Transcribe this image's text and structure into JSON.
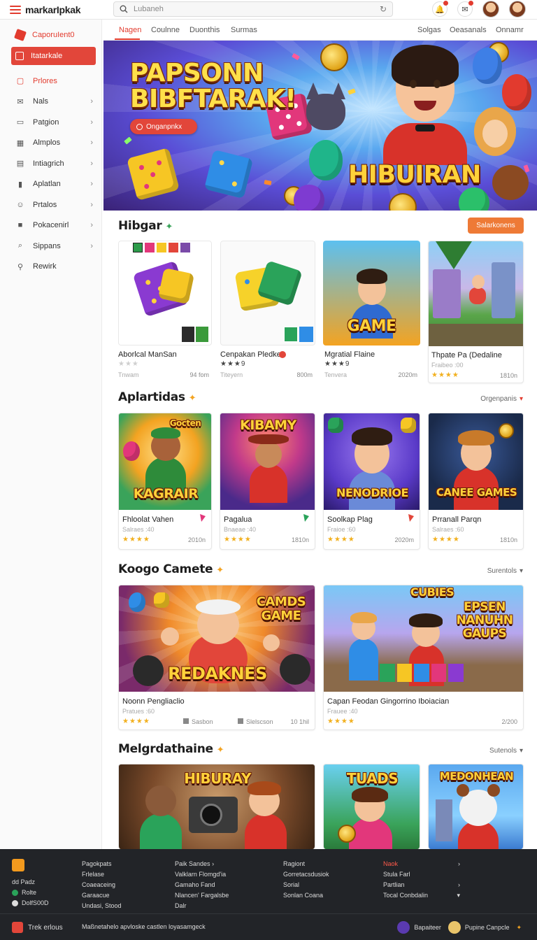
{
  "app": {
    "logo_text": "markarIpkak",
    "search_placeholder": "Lubaneh"
  },
  "sidebar": {
    "top_label": "CaporuIent0",
    "active_label": "Itatarkale",
    "items": [
      {
        "label": "Prlores",
        "icon": "folder-icon",
        "highlight": true,
        "chevron": false
      },
      {
        "label": "Nals",
        "icon": "mail-icon",
        "highlight": false,
        "chevron": true
      },
      {
        "label": "Patgion",
        "icon": "page-icon",
        "highlight": false,
        "chevron": true
      },
      {
        "label": "Almplos",
        "icon": "grid-icon",
        "highlight": false,
        "chevron": true
      },
      {
        "label": "Intiagrich",
        "icon": "doc-icon",
        "highlight": false,
        "chevron": true
      },
      {
        "label": "Aplatlan",
        "icon": "bookmark-icon",
        "highlight": false,
        "chevron": true
      },
      {
        "label": "Prtalos",
        "icon": "user-icon",
        "highlight": false,
        "chevron": true
      },
      {
        "label": "Pokacenirl",
        "icon": "square-icon",
        "highlight": false,
        "chevron": true
      },
      {
        "label": "Sippans",
        "icon": "search-icon",
        "highlight": false,
        "chevron": true
      },
      {
        "label": "Rewirk",
        "icon": "magnifier-icon",
        "highlight": false,
        "chevron": false
      }
    ]
  },
  "tabs": {
    "left": [
      "Nagen",
      "Coulnne",
      "Duonthis",
      "Surmas"
    ],
    "right": [
      "Solgas",
      "Oeasanals",
      "Onnamr"
    ]
  },
  "hero": {
    "title_line1": "PAPSONN",
    "title_line2": "BIBFTARAK!",
    "button_label": "Onganpnkx",
    "badge_text": "HIBUIRAN"
  },
  "sections": [
    {
      "title": "Hibgar",
      "action": "Salarkonens",
      "cards": [
        {
          "title": "Aborlcal ManSan",
          "sub": "",
          "stars": "★★★",
          "meta_left": "Tnwam",
          "meta_right": "94 fom"
        },
        {
          "title": "Cenpakan Pledke",
          "sub": "",
          "stars": "★★★9",
          "meta_left": "Titeyern",
          "meta_right": "800m"
        },
        {
          "title": "Mgratial Flaine",
          "sub": "",
          "stars": "★★★9",
          "meta_left": "Tenvera",
          "meta_right": "2020m",
          "thumb_text": "GAME"
        },
        {
          "title": "Thpate Pa (Dedaline",
          "sub": "Fraibeo :00",
          "stars": "★★★★",
          "meta_left": "",
          "meta_right": "1810n"
        }
      ]
    },
    {
      "title": "Aplartidas",
      "action": "Orgenpanis",
      "cards": [
        {
          "title": "Fhloolat Vahen",
          "sub": "Salraes :40",
          "stars": "★★★★",
          "meta_right": "2010n",
          "thumb_text": "KAGRAIR",
          "thumb_top": "Gocten"
        },
        {
          "title": "Pagalua",
          "sub": "Bnaeae :40",
          "stars": "★★★★",
          "meta_right": "1810n",
          "thumb_text": "KIBAMY"
        },
        {
          "title": "Soolkap Plag",
          "sub": "Fraioe :60",
          "stars": "★★★★",
          "meta_right": "2020m",
          "thumb_text": "NENODRIOE"
        },
        {
          "title": "Prranall Parqn",
          "sub": "Salraes :60",
          "stars": "★★★★",
          "meta_right": "1810n",
          "thumb_text": "CANEE GAMES"
        }
      ]
    },
    {
      "title": "Koogo Camete",
      "action": "Surentols",
      "cards": [
        {
          "title": "Noonn Pengliaclio",
          "sub": "Pratues :60",
          "stars": "★★★★",
          "meta_mid": "Sasbon",
          "meta_mid2": "Slelscson",
          "meta_right": "10 1hil",
          "thumb_text": "REDAKNES",
          "thumb_top": "CAMDS GAME"
        },
        {
          "title": "Capan Feodan Gingorrino Iboiacian",
          "sub": "Frauee :40",
          "stars": "★★★★",
          "meta_right": "2/200",
          "thumb_text": "EPSEN NANUHN GAUPS",
          "thumb_top": "CUBIES"
        }
      ]
    },
    {
      "title": "Melgrdathaine",
      "action": "Sutenols",
      "cards": [
        {
          "thumb_text": "HIBURAY"
        },
        {
          "thumb_text": "TUADS"
        },
        {
          "thumb_text": "MEDONHEAN"
        }
      ]
    }
  ],
  "footer": {
    "social": [
      "dd Padz",
      "Rolte",
      "DolfS00D"
    ],
    "col1": [
      "Pagokpats",
      "Frlelase",
      "Coaeaceing",
      "Garaacue",
      "Undasi, Stood"
    ],
    "col2": [
      "Paik Sandes",
      "Valklarn Flomgd'ia",
      "Gamaho Fand",
      "Nlancen' Fargalsbe",
      "Dalr"
    ],
    "col3": [
      "Ragiont",
      "Gorretacsdusiok",
      "Sorial",
      "Sonlan Coana"
    ],
    "col4": [
      "Naok",
      "Stula Farl",
      "Partlian",
      "Tocal Conbdalin"
    ],
    "brand": "Trek erlous",
    "copyright": "Maßnetahelo apvloske castlen loyasamgeck",
    "badge1": "Bapaiteer",
    "badge2": "Pupine Canpcle"
  },
  "colors": {
    "accent": "#e23b2e",
    "orange": "#ee7a36",
    "footer_bg": "#222428",
    "star": "#f2b01e"
  }
}
